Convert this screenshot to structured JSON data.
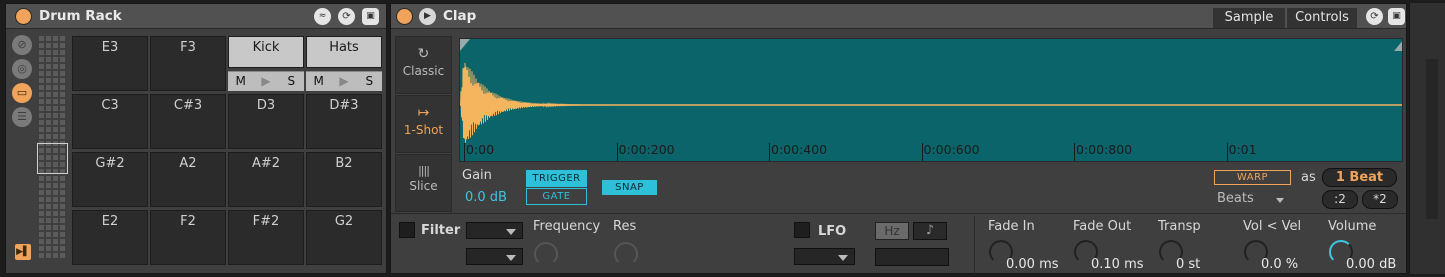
{
  "drum_rack": {
    "title": "Drum Rack",
    "pads": [
      {
        "label": "E3",
        "row": 0,
        "col": 0,
        "active": false
      },
      {
        "label": "F3",
        "row": 0,
        "col": 1,
        "active": false
      },
      {
        "label": "Kick",
        "row": 0,
        "col": 2,
        "active": true
      },
      {
        "label": "Hats",
        "row": 0,
        "col": 3,
        "active": true
      },
      {
        "label": "C3",
        "row": 1,
        "col": 0,
        "active": false
      },
      {
        "label": "C#3",
        "row": 1,
        "col": 1,
        "active": false
      },
      {
        "label": "D3",
        "row": 1,
        "col": 2,
        "active": false
      },
      {
        "label": "D#3",
        "row": 1,
        "col": 3,
        "active": false
      },
      {
        "label": "G#2",
        "row": 2,
        "col": 0,
        "active": false
      },
      {
        "label": "A2",
        "row": 2,
        "col": 1,
        "active": false
      },
      {
        "label": "A#2",
        "row": 2,
        "col": 2,
        "active": false
      },
      {
        "label": "B2",
        "row": 2,
        "col": 3,
        "active": false
      },
      {
        "label": "E2",
        "row": 3,
        "col": 0,
        "active": false
      },
      {
        "label": "F2",
        "row": 3,
        "col": 1,
        "active": false
      },
      {
        "label": "F#2",
        "row": 3,
        "col": 2,
        "active": false
      },
      {
        "label": "G2",
        "row": 3,
        "col": 3,
        "active": false
      }
    ],
    "mute_label": "M",
    "solo_label": "S",
    "play_glyph": "▶"
  },
  "simpler": {
    "title": "Clap",
    "tabs": {
      "sample": "Sample",
      "controls": "Controls"
    },
    "modes": [
      {
        "label": "Classic",
        "icon": "loop-icon",
        "glyph": "↻",
        "active": false
      },
      {
        "label": "1-Shot",
        "icon": "oneshot-icon",
        "glyph": "↦",
        "active": true
      },
      {
        "label": "Slice",
        "icon": "slice-icon",
        "glyph": "||||",
        "active": false
      }
    ],
    "timeline": [
      "0:00",
      "0:00:200",
      "0:00:400",
      "0:00:600",
      "0:00:800",
      "0:01"
    ],
    "gain": {
      "label": "Gain",
      "value": "0.0 dB"
    },
    "trigger_label": "TRIGGER",
    "gate_label": "GATE",
    "snap_label": "SNAP",
    "warp_label": "WARP",
    "as_label": "as",
    "beat_value": "1 Beat",
    "beats_mode": "Beats",
    "div2_label": ":2",
    "mul2_label": "*2",
    "filter_label": "Filter",
    "frequency_label": "Frequency",
    "res_label": "Res",
    "lfo_label": "LFO",
    "hz_label": "Hz",
    "note_glyph": "♪",
    "params": [
      {
        "label": "Fade In",
        "value": "0.00 ms"
      },
      {
        "label": "Fade Out",
        "value": "0.10 ms"
      },
      {
        "label": "Transp",
        "value": "0 st"
      },
      {
        "label": "Vol < Vel",
        "value": "0.0 %"
      },
      {
        "label": "Volume",
        "value": "0.00 dB"
      }
    ]
  },
  "colors": {
    "accent_orange": "#f0a35a",
    "waveform_bg": "#0b6469",
    "waveform": "#f5b45e",
    "cyan": "#3ec6e0"
  }
}
